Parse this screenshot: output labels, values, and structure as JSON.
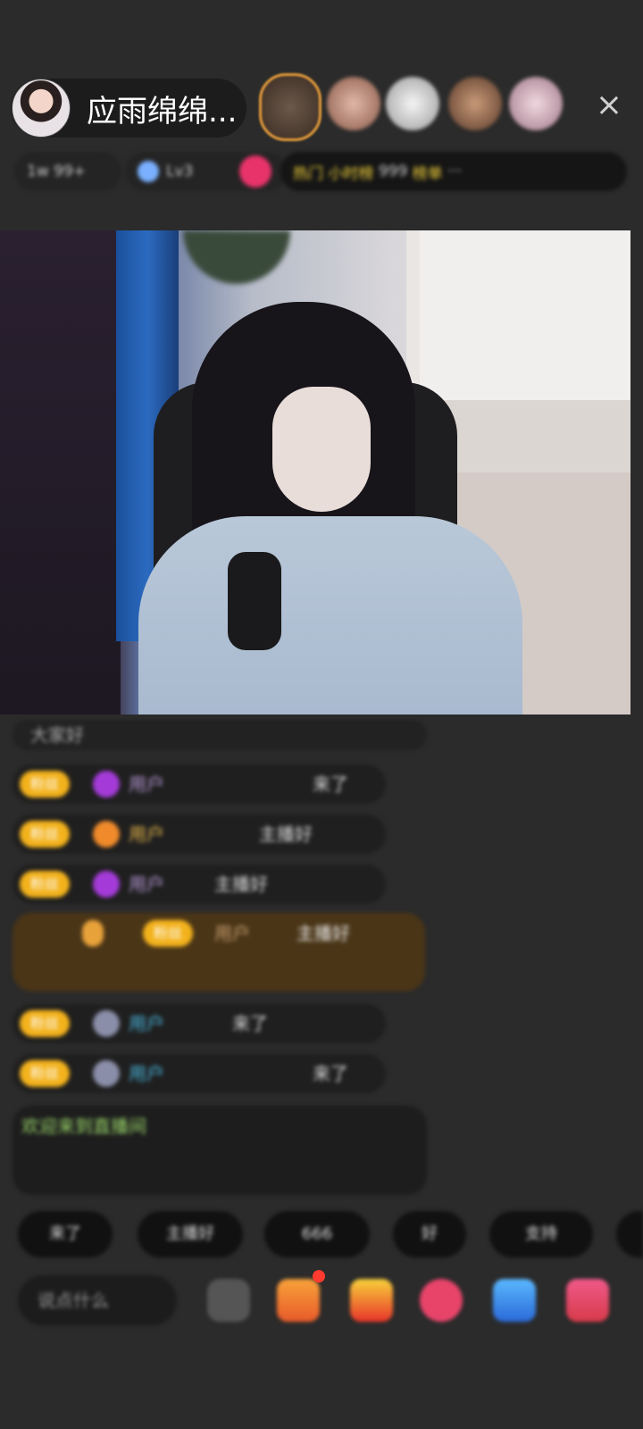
{
  "header": {
    "host_name": "应雨绵绵...",
    "viewers": [
      "viewer-1",
      "viewer-2",
      "viewer-3",
      "viewer-4",
      "viewer-5"
    ],
    "close_icon": "×"
  },
  "info_row": {
    "chips": [
      "1w",
      "99+",
      "Lv3",
      "热门",
      "小时榜",
      "999",
      "榜单",
      "···"
    ]
  },
  "chat": {
    "top_text": "大家好",
    "messages": [
      {
        "badge": "粉丝",
        "user": "用户",
        "text": "来了"
      },
      {
        "badge": "粉丝",
        "user": "用户",
        "text": "主播好"
      },
      {
        "badge": "粉丝",
        "user": "用户",
        "text": "主播好"
      },
      {
        "badge": "粉丝",
        "user": "用户",
        "text": "主播好"
      },
      {
        "badge": "粉丝",
        "user": "用户",
        "text": "来了"
      },
      {
        "badge": "粉丝",
        "user": "用户",
        "text": "来了"
      }
    ],
    "system_notice": "欢迎来到直播间"
  },
  "quick_replies": [
    "来了",
    "主播好",
    "666",
    "好",
    "支持"
  ],
  "input": {
    "placeholder": "说点什么"
  },
  "colors": {
    "background": "#2b2b2b",
    "badge": "#f3b21c",
    "accent_red": "#ff3b30",
    "viewer_ring": "#e39b3a"
  }
}
